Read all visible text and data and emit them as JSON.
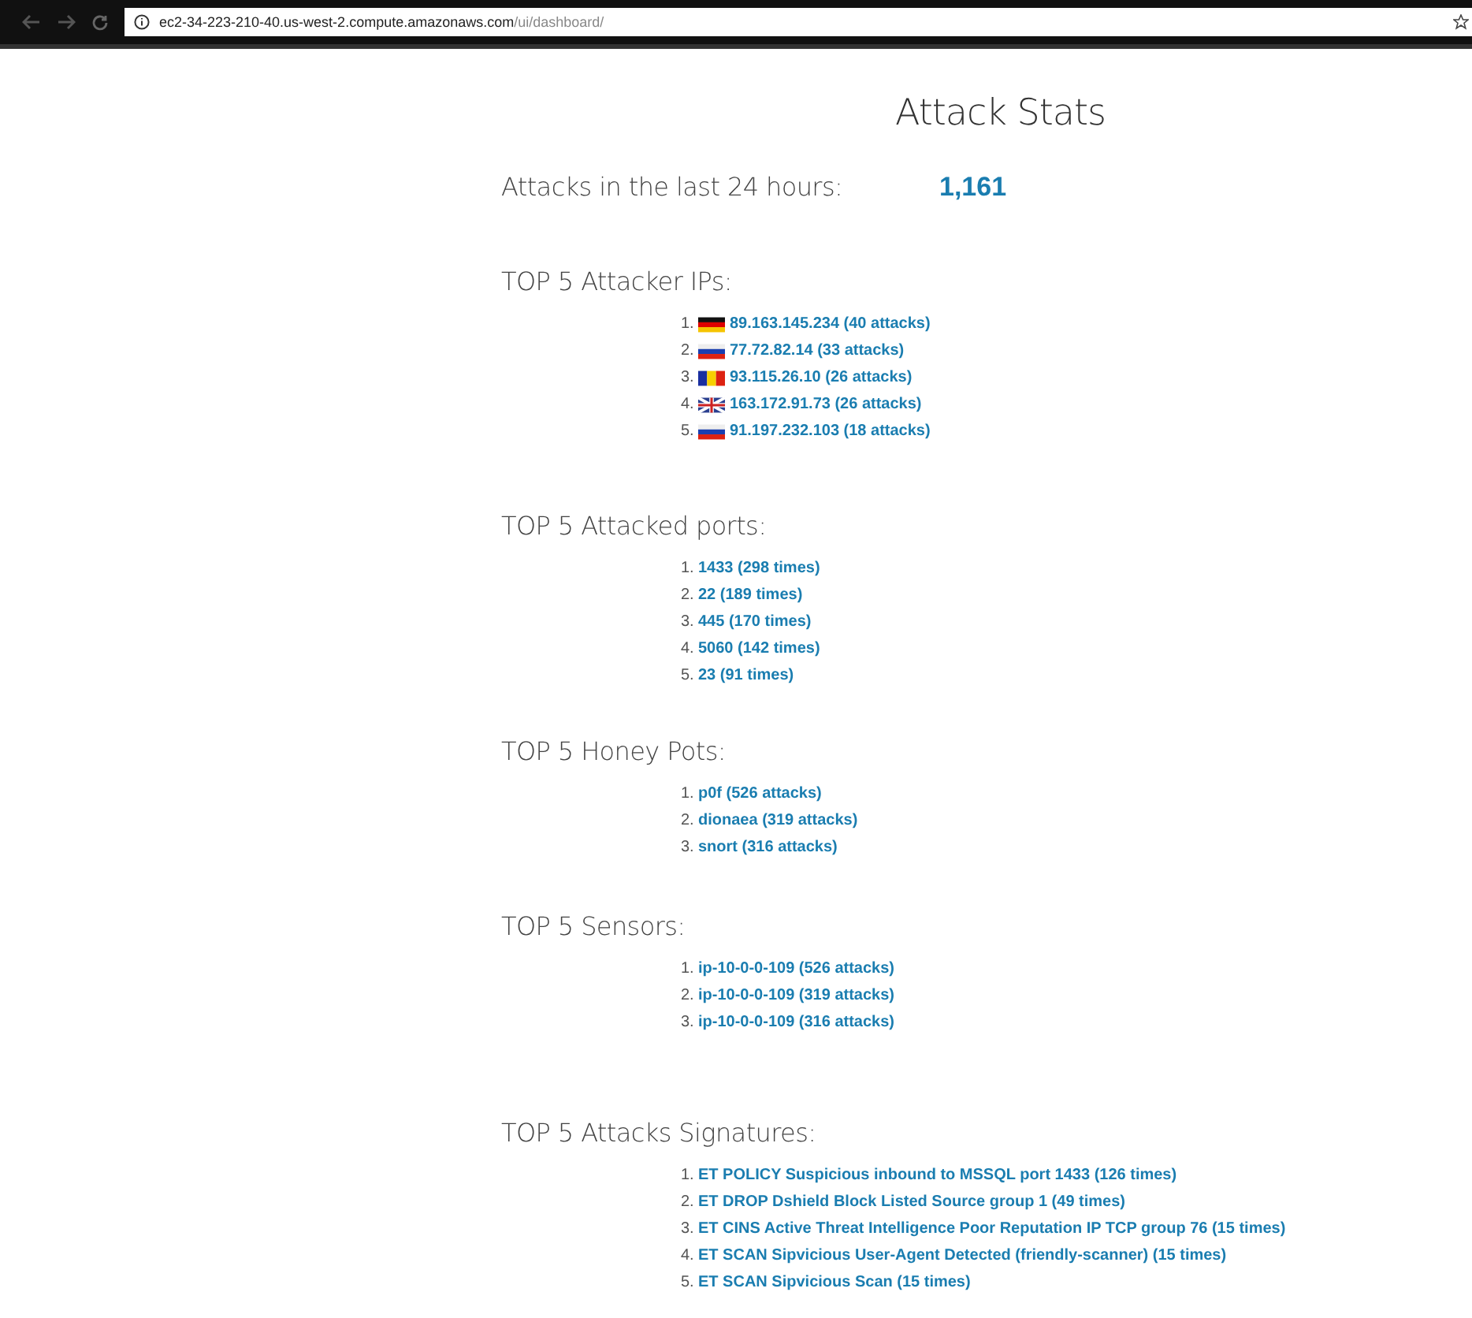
{
  "browser": {
    "url_host": "ec2-34-223-210-40.us-west-2.compute.amazonaws.com",
    "url_path": "/ui/dashboard/"
  },
  "title": "Attack Stats",
  "summary": {
    "label": "Attacks in the last 24 hours:",
    "value": "1,161"
  },
  "sections": [
    {
      "heading": "TOP 5 Attacker IPs:",
      "items": [
        {
          "rank": "1.",
          "kind": "de",
          "text": "89.163.145.234 (40 attacks)"
        },
        {
          "rank": "2.",
          "kind": "ru",
          "text": "77.72.82.14 (33 attacks)"
        },
        {
          "rank": "3.",
          "kind": "ro",
          "text": "93.115.26.10 (26 attacks)"
        },
        {
          "rank": "4.",
          "kind": "gb",
          "text": "163.172.91.73 (26 attacks)"
        },
        {
          "rank": "5.",
          "kind": "ru",
          "text": "91.197.232.103 (18 attacks)"
        }
      ]
    },
    {
      "heading": "TOP 5 Attacked ports:",
      "items": [
        {
          "rank": "1.",
          "text": "1433 (298 times)"
        },
        {
          "rank": "2.",
          "text": "22 (189 times)"
        },
        {
          "rank": "3.",
          "text": "445 (170 times)"
        },
        {
          "rank": "4.",
          "text": "5060 (142 times)"
        },
        {
          "rank": "5.",
          "text": "23 (91 times)"
        }
      ]
    },
    {
      "heading": "TOP 5 Honey Pots:",
      "items": [
        {
          "rank": "1.",
          "text": "p0f (526 attacks)"
        },
        {
          "rank": "2.",
          "text": "dionaea (319 attacks)"
        },
        {
          "rank": "3.",
          "text": "snort (316 attacks)"
        }
      ]
    },
    {
      "heading": "TOP 5 Sensors:",
      "items": [
        {
          "rank": "1.",
          "text": "ip-10-0-0-109 (526 attacks)"
        },
        {
          "rank": "2.",
          "text": "ip-10-0-0-109 (319 attacks)"
        },
        {
          "rank": "3.",
          "text": "ip-10-0-0-109 (316 attacks)"
        }
      ]
    },
    {
      "heading": "TOP 5 Attacks Signatures:",
      "items": [
        {
          "rank": "1.",
          "text": "ET POLICY Suspicious inbound to MSSQL port 1433 (126 times)"
        },
        {
          "rank": "2.",
          "text": "ET DROP Dshield Block Listed Source group 1 (49 times)"
        },
        {
          "rank": "3.",
          "text": "ET CINS Active Threat Intelligence Poor Reputation IP TCP group 76 (15 times)"
        },
        {
          "rank": "4.",
          "text": "ET SCAN Sipvicious User-Agent Detected (friendly-scanner) (15 times)"
        },
        {
          "rank": "5.",
          "text": "ET SCAN Sipvicious Scan (15 times)"
        }
      ]
    }
  ]
}
